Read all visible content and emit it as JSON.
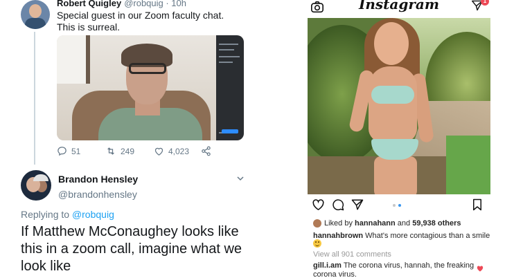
{
  "twitter": {
    "tweet1": {
      "author_name": "Robert Quigley",
      "author_handle": "@robquig · 10h",
      "text": "Special guest in our Zoom faculty chat. This is surreal.",
      "replies": "51",
      "retweets": "249",
      "likes": "4,023"
    },
    "tweet2": {
      "author_name": "Brandon Hensley",
      "author_handle": "@brandonhensley",
      "replying_prefix": "Replying to ",
      "replying_to": "@robquig",
      "text": "If Matthew McConaughey looks like this in a zoom call, imagine what we look like"
    },
    "colors": {
      "link": "#1da1f2",
      "muted": "#657786"
    }
  },
  "instagram": {
    "logo": "Instagram",
    "dm_badge": "1",
    "liked_by_prefix": "Liked by ",
    "liked_by_user": "hannahann",
    "liked_by_and": " and ",
    "liked_by_others": "59,938 others",
    "caption_user": "hannahbrown",
    "caption_text": " What's more contagious than a smile",
    "view_all": "View all 901 comments",
    "comment_user": "gill.i.am",
    "comment_text": " The corona virus, hannah, the freaking corona virus.",
    "colors": {
      "accent": "#3897f0",
      "heart": "#ed4956"
    },
    "icons": [
      "camera-icon",
      "direct-message-icon",
      "heart-icon",
      "comment-icon",
      "share-icon",
      "bookmark-icon"
    ]
  }
}
